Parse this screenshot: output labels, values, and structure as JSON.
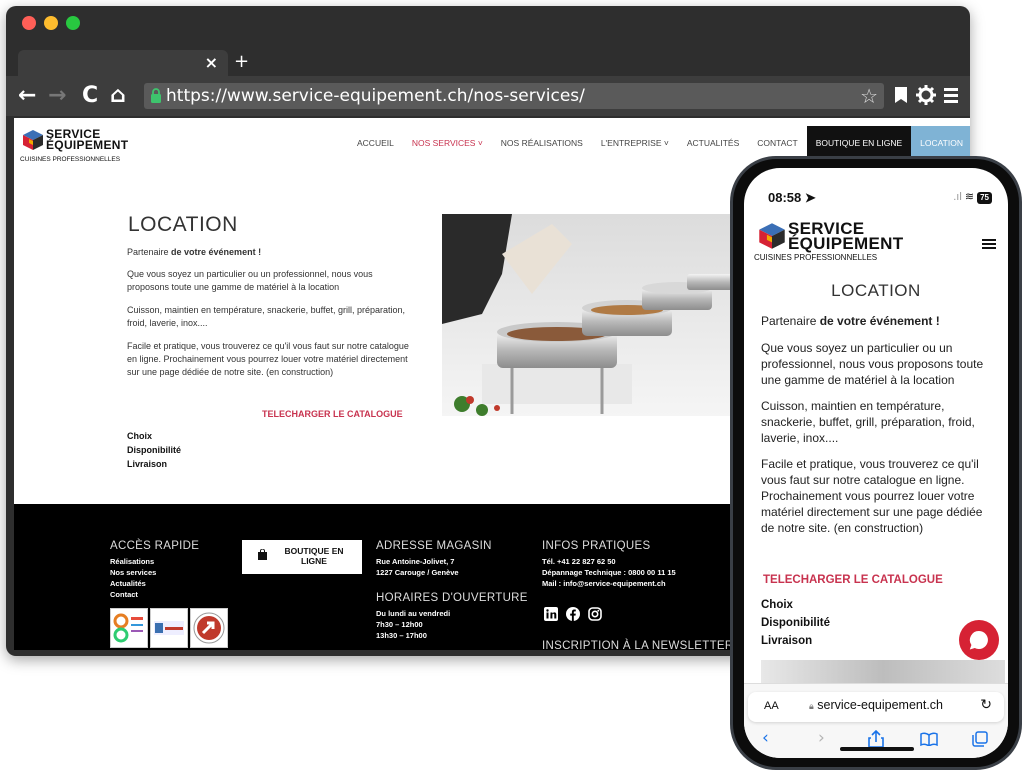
{
  "browser": {
    "tab_close": "×",
    "tab_new": "+",
    "nav": {
      "back": "←",
      "forward": "→",
      "reload": "C",
      "home": "⌂"
    },
    "url": "https://www.service-equipement.ch/nos-services/",
    "icons": {
      "bookmark_star": "star-outline-icon",
      "bookmark": "bookmark-icon",
      "settings": "gear-icon",
      "menu": "hamburger-icon"
    }
  },
  "brand": {
    "line1": "SERVICE",
    "line2": "ÉQUIPEMENT",
    "tagline": "CUISINES PROFESSIONNELLES",
    "colors": {
      "accent": "#c8334f",
      "location_tab": "#7fb3d5",
      "footer_bg": "#000000"
    }
  },
  "site_nav": [
    {
      "label": "ACCUEIL"
    },
    {
      "label": "NOS SERVICES ˅"
    },
    {
      "label": "NOS RÉALISATIONS"
    },
    {
      "label": "L'ENTREPRISE ˅"
    },
    {
      "label": "ACTUALITÉS"
    },
    {
      "label": "CONTACT"
    },
    {
      "label": "BOUTIQUE EN LIGNE"
    },
    {
      "label": "LOCATION"
    }
  ],
  "content": {
    "title": "LOCATION",
    "intro_prefix": "Partenaire ",
    "intro_bold": "de votre événement !",
    "p1": "Que vous soyez un particulier ou un professionnel, nous vous proposons toute une gamme de matériel à la location",
    "p2": "Cuisson, maintien en température, snackerie, buffet, grill, préparation, froid, laverie, inox....",
    "p3": "Facile et pratique, vous trouverez ce qu'il vous faut sur notre catalogue en ligne. Prochainement vous pourrez louer votre matériel directement sur une page dédiée de notre site. (en construction)",
    "download": "TELECHARGER LE CATALOGUE",
    "features": [
      "Choix",
      "Disponibilité",
      "Livraison"
    ]
  },
  "footer": {
    "quick_title": "ACCÈS RAPIDE",
    "quick_links": [
      "Réalisations",
      "Nos services",
      "Actualités",
      "Contact"
    ],
    "shop_button": "BOUTIQUE EN LIGNE",
    "address_title": "ADRESSE MAGASIN",
    "address_lines": [
      "Rue Antoine-Jolivet, 7",
      "1227 Carouge / Genève"
    ],
    "hours_title": "HORAIRES D'OUVERTURE",
    "hours_lines": [
      "Du lundi au vendredi",
      "7h30 – 12h00",
      "13h30 – 17h00"
    ],
    "info_title": "INFOS PRATIQUES",
    "info_lines": [
      "Tél. +41 22 827 62 50",
      "Dépannage Technique : 0800 00 11 15",
      "Mail : info@service-equipement.ch"
    ],
    "newsletter_title": "INSCRIPTION À LA NEWSLETTER",
    "social_icons": [
      "linkedin-icon",
      "facebook-icon",
      "instagram-icon"
    ]
  },
  "phone": {
    "time": "08:58",
    "battery": "75",
    "url": "service-equipement.ch",
    "aa": "AA",
    "toolbar_icons": [
      "back-icon",
      "forward-icon",
      "share-icon",
      "bookmarks-icon",
      "tabs-icon"
    ]
  }
}
